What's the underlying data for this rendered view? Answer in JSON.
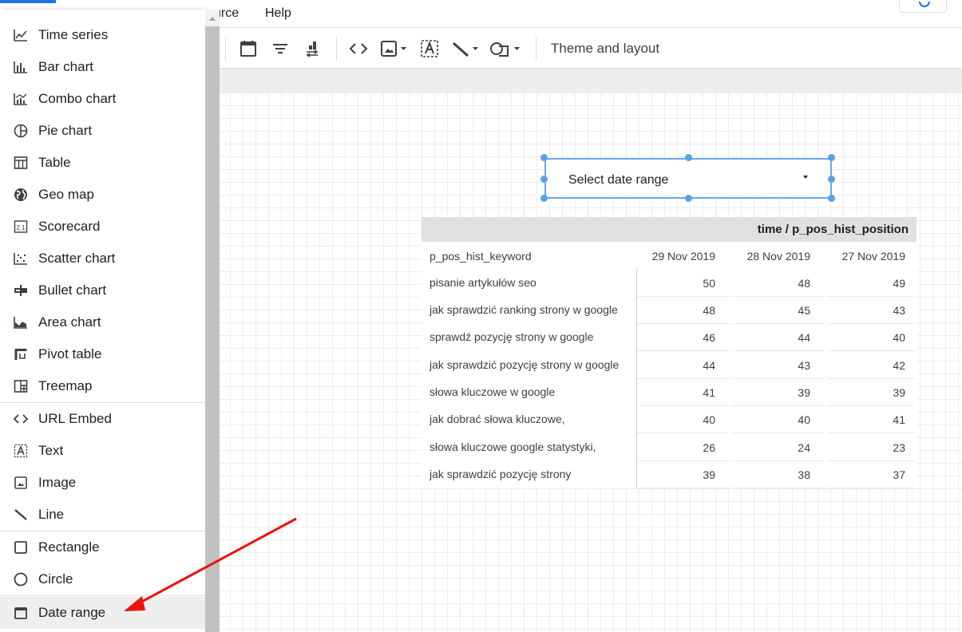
{
  "menubar": {
    "help": "Help",
    "resource_partial": "urce"
  },
  "toolbar": {
    "theme_layout": "Theme and layout",
    "icons": [
      "calendar-icon",
      "filter-icon",
      "data-control-icon",
      "url-embed-icon",
      "image-icon",
      "text-icon",
      "line-icon",
      "shape-icon"
    ]
  },
  "insert_menu": {
    "items": [
      {
        "label": "Time series",
        "icon": "time-series-icon"
      },
      {
        "label": "Bar chart",
        "icon": "bar-chart-icon"
      },
      {
        "label": "Combo chart",
        "icon": "combo-chart-icon"
      },
      {
        "label": "Pie chart",
        "icon": "pie-chart-icon"
      },
      {
        "label": "Table",
        "icon": "table-icon"
      },
      {
        "label": "Geo map",
        "icon": "globe-icon"
      },
      {
        "label": "Scorecard",
        "icon": "scorecard-icon"
      },
      {
        "label": "Scatter chart",
        "icon": "scatter-chart-icon"
      },
      {
        "label": "Bullet chart",
        "icon": "bullet-chart-icon"
      },
      {
        "label": "Area chart",
        "icon": "area-chart-icon"
      },
      {
        "label": "Pivot table",
        "icon": "pivot-table-icon"
      },
      {
        "label": "Treemap",
        "icon": "treemap-icon"
      },
      {
        "label": "URL Embed",
        "icon": "url-embed-icon"
      },
      {
        "label": "Text",
        "icon": "text-icon"
      },
      {
        "label": "Image",
        "icon": "image-icon"
      },
      {
        "label": "Line",
        "icon": "line-icon"
      },
      {
        "label": "Rectangle",
        "icon": "rectangle-icon"
      },
      {
        "label": "Circle",
        "icon": "circle-icon"
      },
      {
        "label": "Date range",
        "icon": "calendar-icon"
      }
    ],
    "scorecard_glyph": "2.1"
  },
  "date_range_control": {
    "label": "Select date range"
  },
  "pivot_table": {
    "header": "time / p_pos_hist_position",
    "row_dimension": "p_pos_hist_keyword",
    "columns": [
      "29 Nov 2019",
      "28 Nov 2019",
      "27 Nov 2019"
    ],
    "rows": [
      {
        "keyword": "pisanie artykułów seo",
        "values": [
          "50",
          "48",
          "49"
        ]
      },
      {
        "keyword": "jak sprawdzić ranking strony w google",
        "values": [
          "48",
          "45",
          "43"
        ]
      },
      {
        "keyword": "sprawdź pozycję strony w google",
        "values": [
          "46",
          "44",
          "40"
        ]
      },
      {
        "keyword": "jak sprawdzić pozycję strony w google",
        "values": [
          "44",
          "43",
          "42"
        ]
      },
      {
        "keyword": "słowa kluczowe w google",
        "values": [
          "41",
          "39",
          "39"
        ]
      },
      {
        "keyword": "jak dobrać słowa kluczowe,",
        "values": [
          "40",
          "40",
          "41"
        ]
      },
      {
        "keyword": "słowa kluczowe google statystyki,",
        "values": [
          "26",
          "24",
          "23"
        ]
      },
      {
        "keyword": "jak sprawdzić pozycję strony",
        "values": [
          "39",
          "38",
          "37"
        ]
      }
    ]
  },
  "colors": {
    "accent": "#1a73e8",
    "selection": "#5aa2e8",
    "arrow": "#e8140f"
  }
}
